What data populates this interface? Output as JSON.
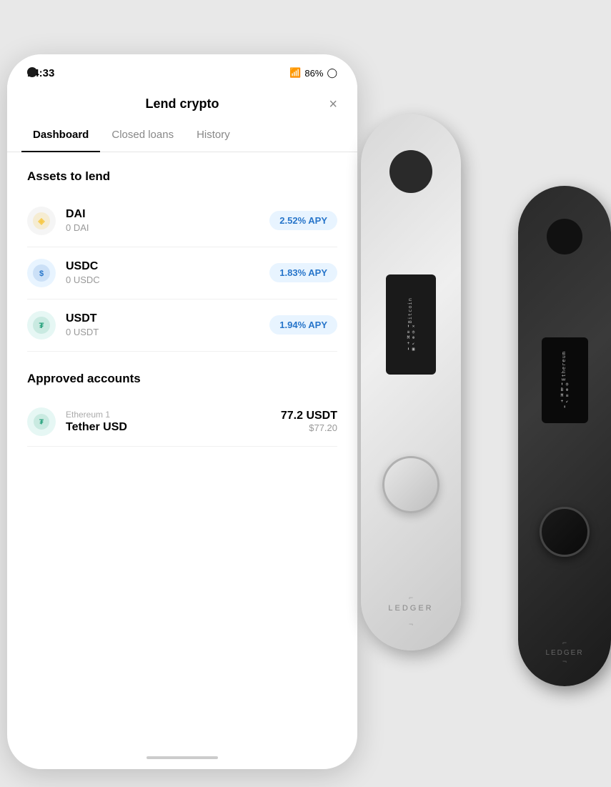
{
  "statusBar": {
    "time": "14:33",
    "battery": "86%"
  },
  "appHeader": {
    "title": "Lend crypto",
    "closeLabel": "×"
  },
  "tabs": [
    {
      "id": "dashboard",
      "label": "Dashboard",
      "active": true
    },
    {
      "id": "closed-loans",
      "label": "Closed loans",
      "active": false
    },
    {
      "id": "history",
      "label": "History",
      "active": false
    }
  ],
  "assetsSection": {
    "title": "Assets to lend",
    "items": [
      {
        "symbol": "DAI",
        "balance": "0 DAI",
        "apy": "2.52% APY",
        "iconType": "dai"
      },
      {
        "symbol": "USDC",
        "balance": "0 USDC",
        "apy": "1.83% APY",
        "iconType": "usdc"
      },
      {
        "symbol": "USDT",
        "balance": "0 USDT",
        "apy": "1.94% APY",
        "iconType": "usdt"
      }
    ]
  },
  "approvedSection": {
    "title": "Approved accounts",
    "items": [
      {
        "subLabel": "Ethereum 1",
        "name": "Tether USD",
        "amount": "77.2 USDT",
        "usdValue": "$77.20",
        "iconType": "usdt"
      }
    ]
  },
  "ledger": {
    "brand": "LEDGER",
    "screen1Lines": [
      "Bitcoin",
      "⬆",
      "≡",
      "✕",
      "+",
      "↙"
    ],
    "screen2Lines": [
      "Ethereum",
      "⬆",
      "≡",
      "✕",
      "+",
      "↙"
    ]
  }
}
